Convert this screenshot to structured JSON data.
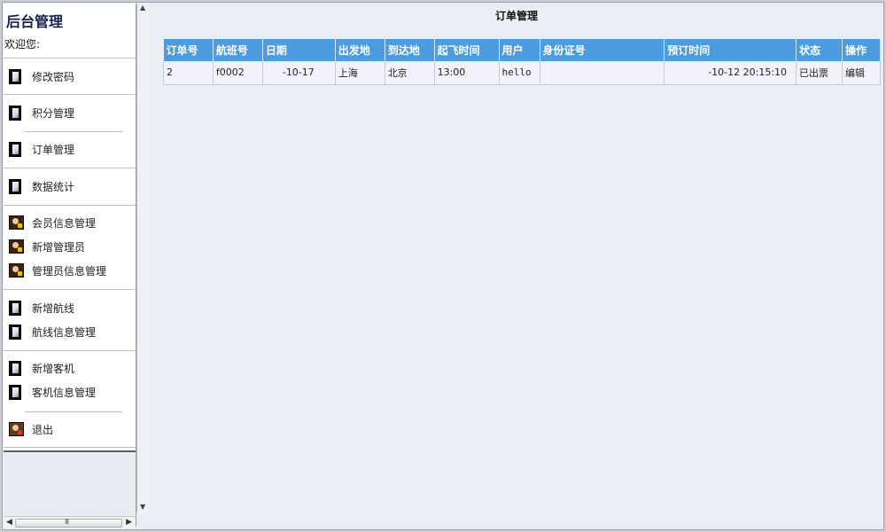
{
  "sidebar": {
    "title": "后台管理",
    "welcome": "欢迎您:",
    "items": [
      {
        "label": "修改密码",
        "icon": "book-icon"
      },
      {
        "label": "积分管理",
        "icon": "book-icon"
      },
      {
        "label": "订单管理",
        "icon": "book-icon"
      },
      {
        "label": "数据统计",
        "icon": "book-icon"
      },
      {
        "label": "会员信息管理",
        "icon": "user-icon"
      },
      {
        "label": "新增管理员",
        "icon": "user-icon"
      },
      {
        "label": "管理员信息管理",
        "icon": "user-icon"
      },
      {
        "label": "新增航线",
        "icon": "book-icon"
      },
      {
        "label": "航线信息管理",
        "icon": "book-icon"
      },
      {
        "label": "新增客机",
        "icon": "book-icon"
      },
      {
        "label": "客机信息管理",
        "icon": "book-icon"
      },
      {
        "label": "退出",
        "icon": "exit-user-icon"
      }
    ],
    "hscroll_grip": "III"
  },
  "main": {
    "title": "订单管理",
    "table": {
      "headers": [
        "订单号",
        "航班号",
        "日期",
        "出发地",
        "到达地",
        "起飞时间",
        "用户",
        "身份证号",
        "预订时间",
        "状态",
        "操作"
      ],
      "rows": [
        [
          "2",
          "f0002",
          "-10-17",
          "上海",
          "北京",
          "13:00",
          "hello",
          "",
          "-10-12 20:15:10",
          "已出票",
          "编辑"
        ]
      ]
    }
  },
  "colors": {
    "header_bg": "#4d9ce0",
    "status_issued": "#d13a1a",
    "brand": "#14224a"
  }
}
